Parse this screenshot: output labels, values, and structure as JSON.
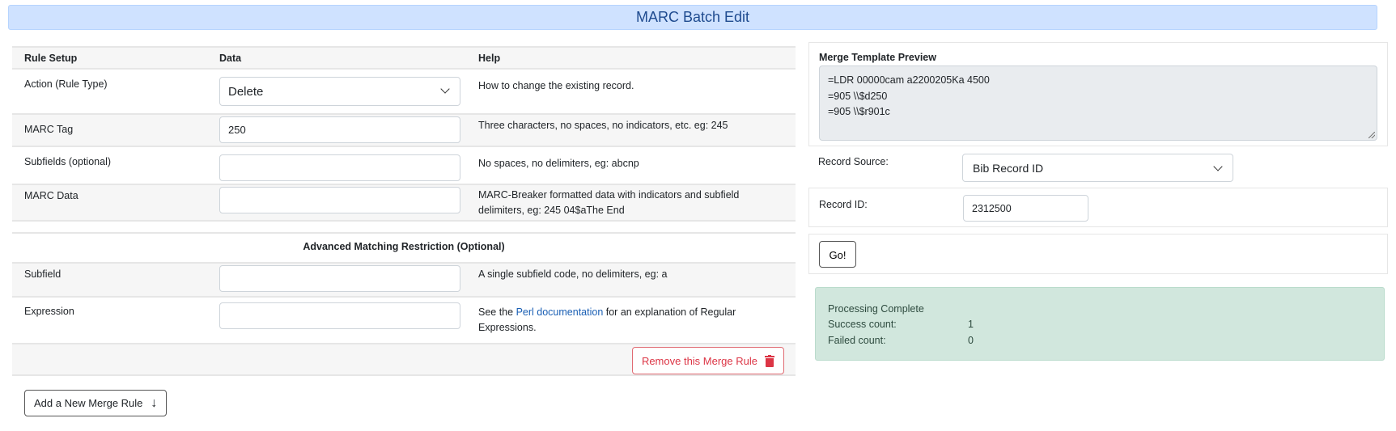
{
  "page": {
    "title": "MARC Batch Edit"
  },
  "rules_table": {
    "headers": {
      "rule_setup": "Rule Setup",
      "data": "Data",
      "help": "Help"
    },
    "rows": [
      {
        "label": "Action (Rule Type)",
        "value": "Delete",
        "help": "How to change the existing record."
      },
      {
        "label": "MARC Tag",
        "value": "250",
        "help": "Three characters, no spaces, no indicators, etc. eg: 245"
      },
      {
        "label": "Subfields (optional)",
        "value": "",
        "help": "No spaces, no delimiters, eg: abcnp"
      },
      {
        "label": "MARC Data",
        "value": "",
        "help": "MARC-Breaker formatted data with indicators and subfield delimiters, eg: 245 04$aThe End"
      }
    ],
    "advanced": {
      "title": "Advanced Matching Restriction (Optional)",
      "rows": [
        {
          "label": "Subfield",
          "value": "",
          "help": "A single subfield code, no delimiters, eg: a"
        },
        {
          "label": "Expression",
          "value": "",
          "help_prefix": "See the ",
          "help_link": "Perl documentation",
          "help_suffix": " for an explanation of Regular Expressions."
        }
      ]
    },
    "remove_button": "Remove this Merge Rule",
    "add_button": "Add a New Merge Rule"
  },
  "preview": {
    "title": "Merge Template Preview",
    "lines": [
      "=LDR 00000cam a2200205Ka 4500",
      "=905 \\\\$d250",
      "=905 \\\\$r901c"
    ]
  },
  "record": {
    "source_label": "Record Source:",
    "source_value": "Bib Record ID",
    "id_label": "Record ID:",
    "id_value": "2312500",
    "go_button": "Go!"
  },
  "status": {
    "title": "Processing Complete",
    "success_label": "Success count:",
    "success_value": "1",
    "failed_label": "Failed count:",
    "failed_value": "0",
    "color": "#d1e7dd"
  }
}
